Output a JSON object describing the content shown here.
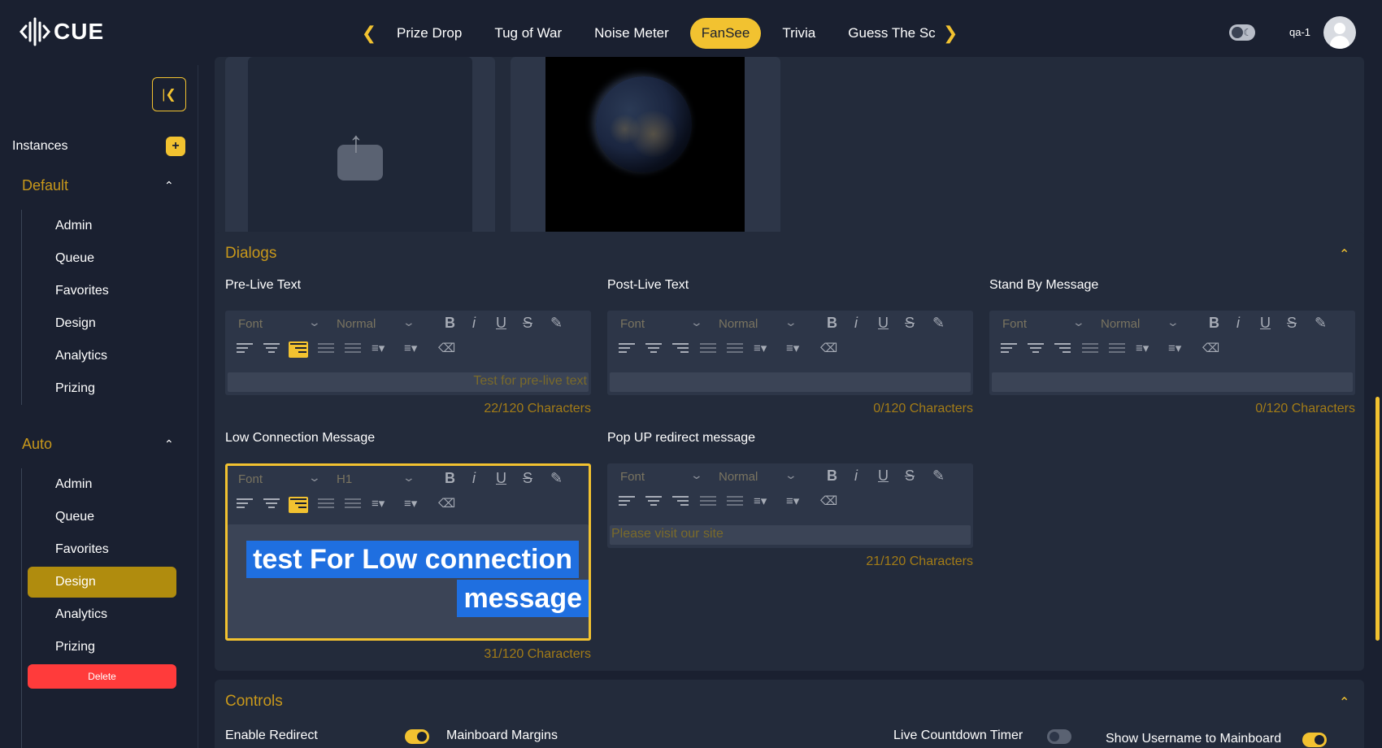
{
  "app": {
    "logo_text": "CUE"
  },
  "tabs": [
    "Prize Drop",
    "Tug of War",
    "Noise Meter",
    "FanSee",
    "Trivia",
    "Guess The Sco"
  ],
  "active_tab": "FanSee",
  "user": {
    "name": "qa-1"
  },
  "sidebar": {
    "instances_label": "Instances",
    "add_label": "+",
    "groups": [
      {
        "title": "Default",
        "items": [
          "Admin",
          "Queue",
          "Favorites",
          "Design",
          "Analytics",
          "Prizing"
        ]
      },
      {
        "title": "Auto",
        "items": [
          "Admin",
          "Queue",
          "Favorites",
          "Design",
          "Analytics",
          "Prizing"
        ]
      }
    ],
    "active_item": "Auto / Design",
    "delete_label": "Delete"
  },
  "dialogs": {
    "title": "Dialogs",
    "fields": [
      {
        "label": "Pre-Live Text",
        "font": "Font",
        "size": "Normal",
        "text": "Test for pre-live text",
        "counter": "22/120 Characters"
      },
      {
        "label": "Post-Live Text",
        "font": "Font",
        "size": "Normal",
        "text": "",
        "counter": "0/120 Characters"
      },
      {
        "label": "Stand By Message",
        "font": "Font",
        "size": "Normal",
        "text": "",
        "counter": "0/120 Characters"
      },
      {
        "label": "Low Connection Message",
        "font": "Font",
        "size": "H1",
        "text_line1": "test For Low connection",
        "text_line2": "message",
        "counter": "31/120 Characters"
      },
      {
        "label": "Pop UP redirect message",
        "font": "Font",
        "size": "Normal",
        "text": "Please visit our site",
        "counter": "21/120 Characters"
      }
    ]
  },
  "controls": {
    "title": "Controls",
    "items": [
      {
        "label": "Enable Redirect",
        "on": true
      },
      {
        "label": "Mainboard Margins"
      },
      {
        "label": "Live Countdown Timer",
        "on": false
      },
      {
        "label": "Show Username to Mainboard",
        "on": true
      }
    ]
  },
  "colors": {
    "accent": "#f2c230",
    "background": "#1a2030",
    "panel": "#232b3b",
    "danger": "#ff3b3b",
    "selection": "#1f6fe0"
  }
}
